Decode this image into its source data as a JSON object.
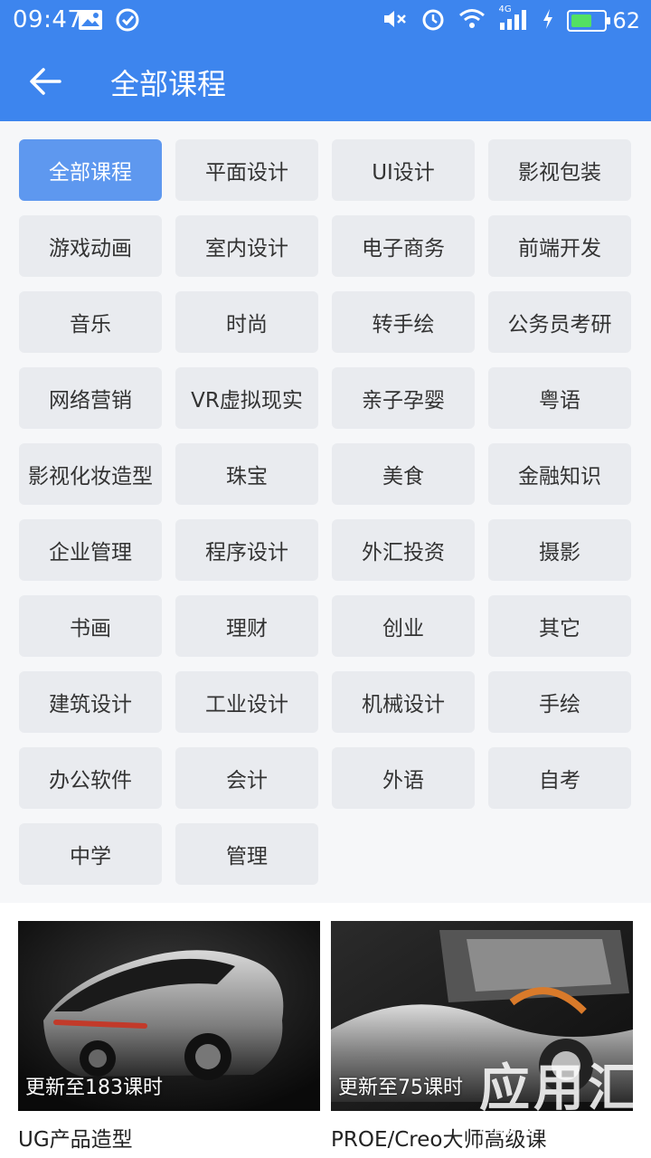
{
  "status_bar": {
    "time": "09:47",
    "network": "4G",
    "battery_level": "62",
    "battery_color": "#53e063"
  },
  "header": {
    "title": "全部课程",
    "background": "#3d85ee"
  },
  "categories": [
    {
      "label": "全部课程",
      "selected": true
    },
    {
      "label": "平面设计"
    },
    {
      "label": "UI设计"
    },
    {
      "label": "影视包装"
    },
    {
      "label": "游戏动画"
    },
    {
      "label": "室内设计"
    },
    {
      "label": "电子商务"
    },
    {
      "label": "前端开发"
    },
    {
      "label": "音乐"
    },
    {
      "label": "时尚"
    },
    {
      "label": "转手绘"
    },
    {
      "label": "公务员考研"
    },
    {
      "label": "网络营销"
    },
    {
      "label": "VR虚拟现实"
    },
    {
      "label": "亲子孕婴"
    },
    {
      "label": "粤语"
    },
    {
      "label": "影视化妆造型"
    },
    {
      "label": "珠宝"
    },
    {
      "label": "美食"
    },
    {
      "label": "金融知识"
    },
    {
      "label": "企业管理"
    },
    {
      "label": "程序设计"
    },
    {
      "label": "外汇投资"
    },
    {
      "label": "摄影"
    },
    {
      "label": "书画"
    },
    {
      "label": "理财"
    },
    {
      "label": "创业"
    },
    {
      "label": "其它"
    },
    {
      "label": "建筑设计"
    },
    {
      "label": "工业设计"
    },
    {
      "label": "机械设计"
    },
    {
      "label": "手绘"
    },
    {
      "label": "办公软件"
    },
    {
      "label": "会计"
    },
    {
      "label": "外语"
    },
    {
      "label": "自考"
    },
    {
      "label": "中学"
    },
    {
      "label": "管理"
    }
  ],
  "courses": [
    {
      "update": "更新至183课时",
      "name": "UG产品造型"
    },
    {
      "update": "更新至75课时",
      "name": "PROE/Creo大师高级课"
    }
  ],
  "watermark": {
    "brand": "应用汇",
    "site": "AppChina.com"
  }
}
